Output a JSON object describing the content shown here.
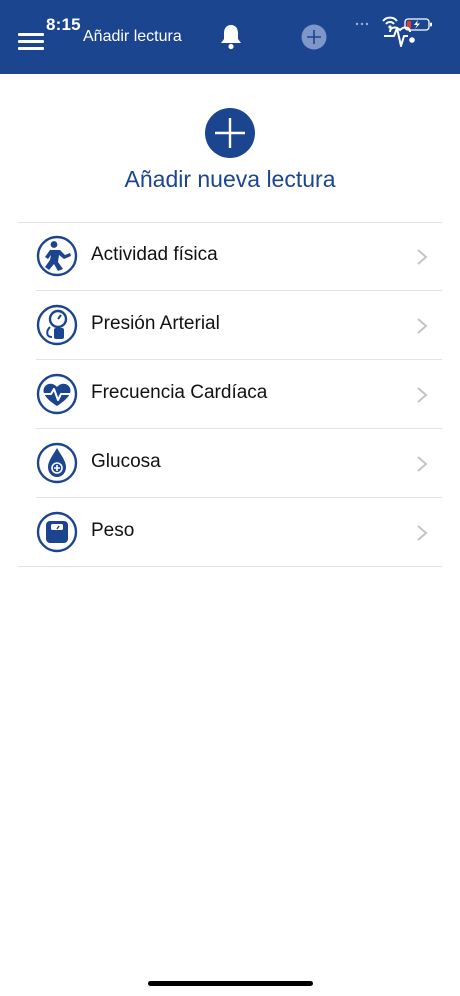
{
  "status_bar": {
    "time": "8:15"
  },
  "header": {
    "title": "Añadir lectura",
    "icons": [
      "menu-icon",
      "bell-icon",
      "plus-circle-icon",
      "heart-pulse-icon"
    ]
  },
  "main": {
    "add_title": "Añadir nueva lectura",
    "items": [
      {
        "label": "Actividad física",
        "icon": "activity-icon"
      },
      {
        "label": "Presión Arterial",
        "icon": "blood-pressure-icon"
      },
      {
        "label": "Frecuencia Cardíaca",
        "icon": "heart-rate-icon"
      },
      {
        "label": "Glucosa",
        "icon": "glucose-icon"
      },
      {
        "label": "Peso",
        "icon": "scale-icon"
      }
    ]
  },
  "colors": {
    "primary": "#1c4590",
    "background": "#ffffff",
    "divider": "#e3e3e3"
  }
}
